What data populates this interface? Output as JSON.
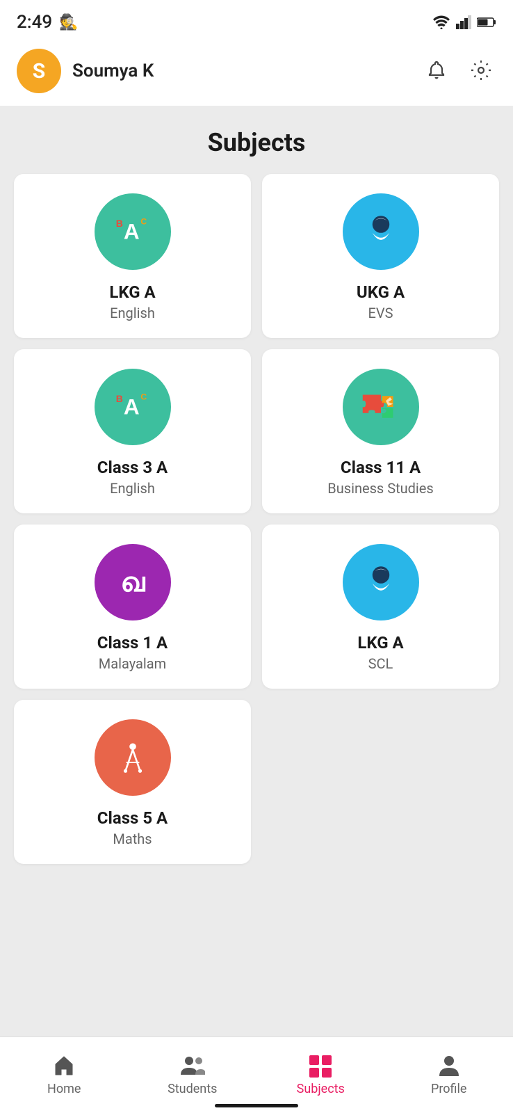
{
  "statusBar": {
    "time": "2:49",
    "spyIcon": "🕵",
    "wifi": "wifi",
    "signal": "signal",
    "battery": "battery"
  },
  "header": {
    "avatarLetter": "S",
    "avatarColor": "#F5A623",
    "userName": "Soumya K",
    "bellIcon": "bell-icon",
    "gearIcon": "gear-icon"
  },
  "pageTitle": "Subjects",
  "subjects": [
    {
      "id": 1,
      "className": "LKG A",
      "subject": "English",
      "iconType": "english",
      "color": "#3dbf9e"
    },
    {
      "id": 2,
      "className": "UKG A",
      "subject": "EVS",
      "iconType": "evs",
      "color": "#29b6e8"
    },
    {
      "id": 3,
      "className": "Class 3 A",
      "subject": "English",
      "iconType": "english",
      "color": "#3dbf9e"
    },
    {
      "id": 4,
      "className": "Class 11 A",
      "subject": "Business Studies",
      "iconType": "business",
      "color": "#3dbf9e"
    },
    {
      "id": 5,
      "className": "Class 1 A",
      "subject": "Malayalam",
      "iconType": "malayalam",
      "color": "#9c27b0"
    },
    {
      "id": 6,
      "className": "LKG A",
      "subject": "SCL",
      "iconType": "scl",
      "color": "#29b6e8"
    },
    {
      "id": 7,
      "className": "Class 5 A",
      "subject": "Maths",
      "iconType": "maths",
      "color": "#e8654a"
    }
  ],
  "bottomNav": {
    "items": [
      {
        "id": "home",
        "label": "Home",
        "active": false
      },
      {
        "id": "students",
        "label": "Students",
        "active": false
      },
      {
        "id": "subjects",
        "label": "Subjects",
        "active": true
      },
      {
        "id": "profile",
        "label": "Profile",
        "active": false
      }
    ]
  }
}
